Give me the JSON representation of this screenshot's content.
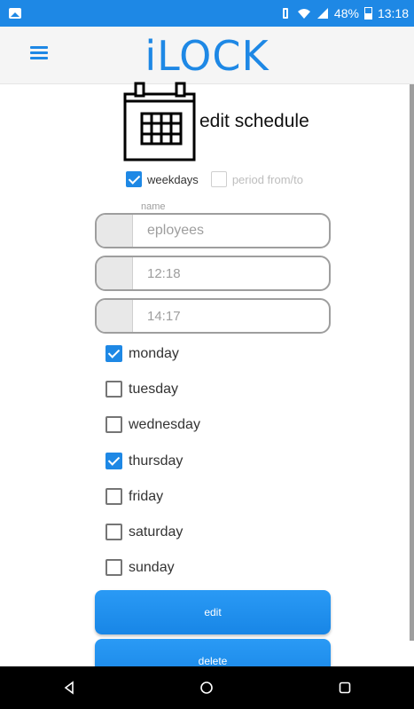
{
  "status_bar": {
    "battery_percent": "48%",
    "time": "13:18"
  },
  "app_bar": {
    "title": "iLOCK"
  },
  "header": {
    "title": "edit schedule"
  },
  "mode": {
    "weekdays_label": "weekdays",
    "weekdays_checked": true,
    "period_label": "period from/to",
    "period_checked": false
  },
  "form": {
    "name_caption": "name",
    "name_value": "eployees",
    "start_time": "12:18",
    "end_time": "14:17"
  },
  "days": [
    {
      "label": "monday",
      "checked": true
    },
    {
      "label": "tuesday",
      "checked": false
    },
    {
      "label": "wednesday",
      "checked": false
    },
    {
      "label": "thursday",
      "checked": true
    },
    {
      "label": "friday",
      "checked": false
    },
    {
      "label": "saturday",
      "checked": false
    },
    {
      "label": "sunday",
      "checked": false
    }
  ],
  "buttons": {
    "edit": "edit",
    "delete": "delete"
  },
  "colors": {
    "accent": "#1e88e5",
    "statusbar": "#1e88e5",
    "navbar": "#000000"
  },
  "icons": {
    "menu": "hamburger-menu-icon",
    "calendar": "calendar-icon",
    "back": "nav-back-icon",
    "home": "nav-home-icon",
    "recents": "nav-recents-icon"
  }
}
